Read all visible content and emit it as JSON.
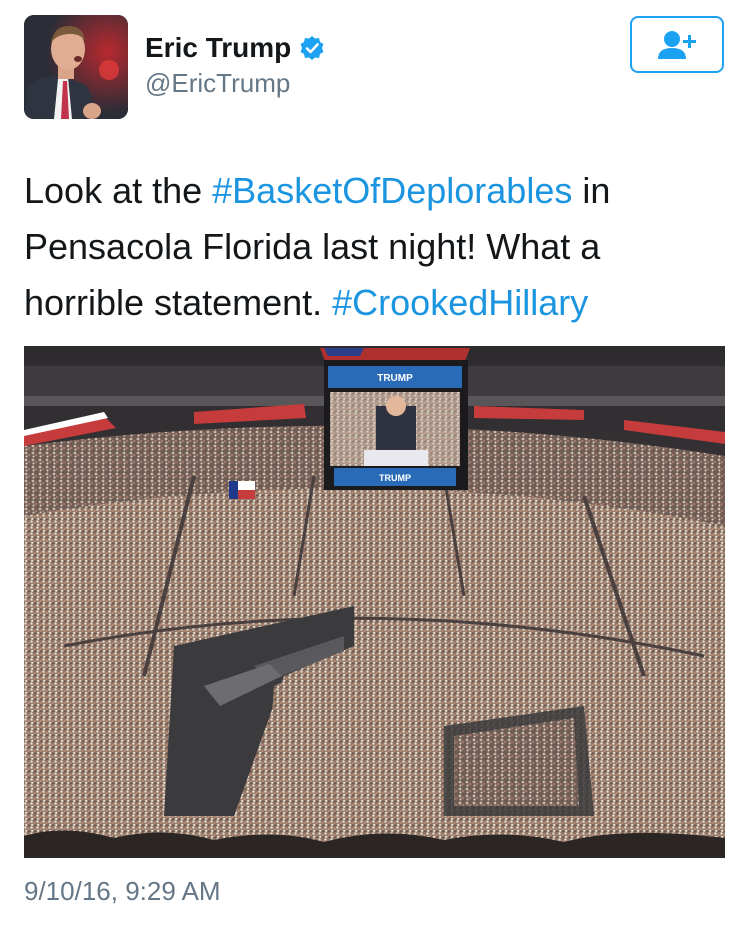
{
  "author": {
    "display_name": "Eric Trump",
    "handle": "@EricTrump",
    "verified": true,
    "avatar_icon": "profile-photo",
    "verified_icon": "verified-badge-icon"
  },
  "follow_button": {
    "icon": "follow-user-plus-icon",
    "color": "#1da1f2"
  },
  "tweet": {
    "text_1": "Look at the ",
    "hashtag_1": "#BasketOfDeplorables",
    "text_2": " in Pensacola Florida last night! What a horrible statement. ",
    "hashtag_2": "#CrookedHillary"
  },
  "media": {
    "type": "photo",
    "screen_sign_top": "TRUMP",
    "screen_sign_bottom": "TRUMP"
  },
  "timestamp": "9/10/16, 9:29 AM",
  "colors": {
    "hashtag": "#1b95e0",
    "secondary_text": "#657786",
    "primary_text": "#14171a"
  }
}
